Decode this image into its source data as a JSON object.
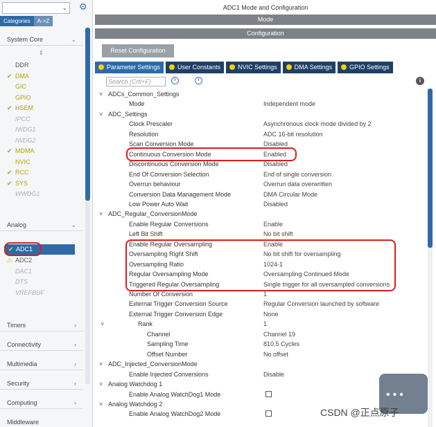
{
  "left": {
    "tabs": [
      "Categories",
      "A->Z"
    ],
    "groups": {
      "system_core": "System Core",
      "analog": "Analog",
      "timers": "Timers",
      "connectivity": "Connectivity",
      "multimedia": "Multimedia",
      "security": "Security",
      "computing": "Computing",
      "middleware": "Middleware"
    },
    "system_core_items": [
      {
        "label": "DDR",
        "state": "plain"
      },
      {
        "label": "DMA",
        "state": "ok"
      },
      {
        "label": "GIC",
        "state": "ok_nocheck"
      },
      {
        "label": "GPIO",
        "state": "ok_nocheck"
      },
      {
        "label": "HSEM",
        "state": "ok"
      },
      {
        "label": "IPCC",
        "state": "disabled"
      },
      {
        "label": "IWDG1",
        "state": "disabled"
      },
      {
        "label": "IWDG2",
        "state": "disabled"
      },
      {
        "label": "MDMA",
        "state": "ok"
      },
      {
        "label": "NVIC",
        "state": "ok_nocheck"
      },
      {
        "label": "RCC",
        "state": "ok"
      },
      {
        "label": "SYS",
        "state": "ok"
      },
      {
        "label": "WWDG1",
        "state": "disabled"
      }
    ],
    "analog_items": [
      {
        "label": "ADC1",
        "state": "selected"
      },
      {
        "label": "ADC2",
        "state": "warn"
      },
      {
        "label": "DAC1",
        "state": "disabled"
      },
      {
        "label": "DTS",
        "state": "disabled"
      },
      {
        "label": "VREFBUF",
        "state": "disabled"
      }
    ]
  },
  "right": {
    "title": "ADC1 Mode and Configuration",
    "mode_label": "Mode",
    "config_label": "Configuration",
    "reset_button": "Reset Configuration",
    "tabs": [
      "Parameter Settings",
      "User Constants",
      "NVIC Settings",
      "DMA Settings",
      "GPIO Settings"
    ],
    "search_placeholder": "Search (Crtl+F)",
    "tree": [
      {
        "level": 0,
        "name": "ADCs_Common_Settings",
        "value": ""
      },
      {
        "level": 1,
        "name": "Mode",
        "value": "Independent mode"
      },
      {
        "level": 0,
        "name": "ADC_Settings",
        "value": ""
      },
      {
        "level": 1,
        "name": "Clock Prescaler",
        "value": "Asynchronous clock mode divided by 2"
      },
      {
        "level": 1,
        "name": "Resolution",
        "value": "ADC 16-bit resolution"
      },
      {
        "level": 1,
        "name": "Scan Conversion Mode",
        "value": "Disabled"
      },
      {
        "level": 1,
        "name": "Continuous Conversion Mode",
        "value": "Enabled"
      },
      {
        "level": 1,
        "name": "Discontinuous Conversion Mode",
        "value": "Disabled"
      },
      {
        "level": 1,
        "name": "End Of Conversion Selection",
        "value": "End of single conversion"
      },
      {
        "level": 1,
        "name": "Overrun behaviour",
        "value": "Overrun data overwritten"
      },
      {
        "level": 1,
        "name": "Conversion Data Management Mode",
        "value": "DMA Circular Mode"
      },
      {
        "level": 1,
        "name": "Low Power Auto Wait",
        "value": "Disabled"
      },
      {
        "level": 0,
        "name": "ADC_Regular_ConversionMode",
        "value": ""
      },
      {
        "level": 1,
        "name": "Enable Regular Conversions",
        "value": "Enable"
      },
      {
        "level": 1,
        "name": "Left Bit Shift",
        "value": "No bit shift"
      },
      {
        "level": 1,
        "name": "Enable Regular Oversampling",
        "value": "Enable"
      },
      {
        "level": 1,
        "name": "Oversampling Right Shift",
        "value": "No bit shift for oversampling"
      },
      {
        "level": 1,
        "name": "Oversampling Ratio",
        "value": "1024-1"
      },
      {
        "level": 1,
        "name": "Regular Oversampling Mode",
        "value": "Oversampling Continued Mode"
      },
      {
        "level": 1,
        "name": "Triggered Regular Oversampling",
        "value": "Single trigger for all oversampled conversions"
      },
      {
        "level": 1,
        "name": "Number Of Conversion",
        "value": "1"
      },
      {
        "level": 1,
        "name": "External Trigger Conversion Source",
        "value": "Regular Conversion launched by software"
      },
      {
        "level": 1,
        "name": "External Trigger Conversion Edge",
        "value": "None"
      },
      {
        "level": 2,
        "name": "Rank",
        "value": "1"
      },
      {
        "level": 3,
        "name": "Channel",
        "value": "Channel 19"
      },
      {
        "level": 3,
        "name": "Sampling Time",
        "value": "810.5 Cycles"
      },
      {
        "level": 3,
        "name": "Offset Number",
        "value": "No offset"
      },
      {
        "level": 0,
        "name": "ADC_Injected_ConversionMode",
        "value": ""
      },
      {
        "level": 1,
        "name": "Enable Injected Conversions",
        "value": "Disable"
      },
      {
        "level": 0,
        "name": "Analog Watchdog 1",
        "value": ""
      },
      {
        "level": 1,
        "name": "Enable Analog WatchDog1 Mode",
        "value": "[checkbox]"
      },
      {
        "level": 0,
        "name": "Analog Watchdog 2",
        "value": ""
      },
      {
        "level": 1,
        "name": "Enable Analog WatchDog2 Mode",
        "value": "[checkbox]"
      }
    ]
  },
  "watermark": "CSDN @正点原子",
  "colors": {
    "accent_blue": "#2f6aa7",
    "dark_tab": "#1f3f66",
    "gray_bar": "#7c8287",
    "highlight_red": "#d81e1e",
    "ok_yellow": "#b7a600",
    "check_green": "#7cb342"
  }
}
